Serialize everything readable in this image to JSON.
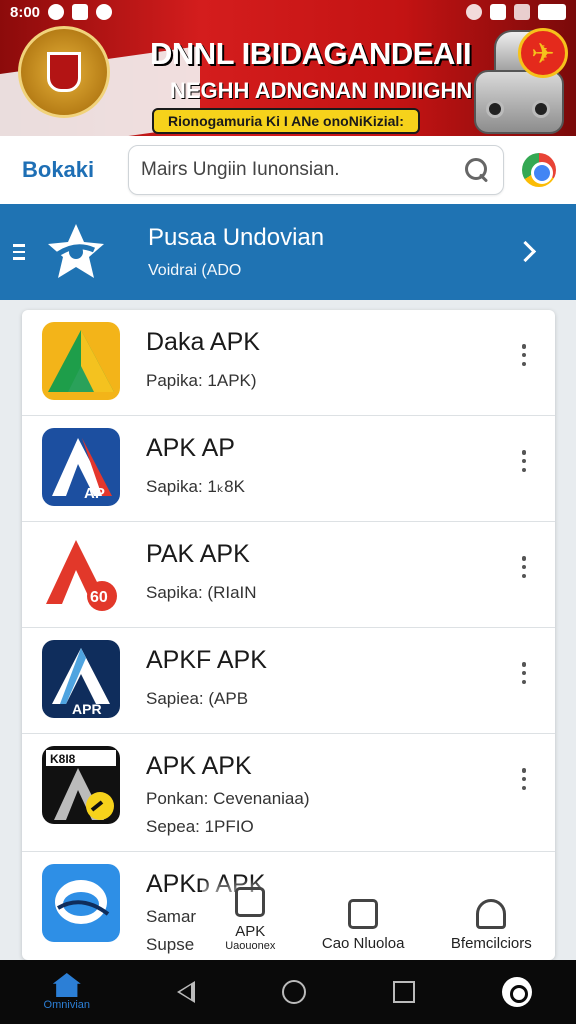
{
  "status_bar": {
    "time": "8:00"
  },
  "banner": {
    "title": "DNNL IBIDAGANDEAII",
    "subtitle": "NEGHH ADNGNAN INDIIGHN",
    "ribbon": "Rionogamuria Ki I ANe onoNiKizial:"
  },
  "header": {
    "brand": "Bokaki",
    "search_placeholder": "Mairs Ungiin Iunonsian."
  },
  "promo": {
    "title": "Pusaa Undovian",
    "subtitle": "Voidrai (ADO"
  },
  "apps": [
    {
      "name": "Daka APK",
      "meta": "Papika: 1APK)"
    },
    {
      "name": "APK AP",
      "meta": "Sapika: 1ₖ8K"
    },
    {
      "name": "PAK APK",
      "meta": "Sapika: (RIaIN"
    },
    {
      "name": "APKF APK",
      "meta": "Sapiea: (APB"
    },
    {
      "name": "APK APK",
      "meta": "Ponkan: Cevenaniaa)",
      "meta2": "Sepea: 1PFIO"
    },
    {
      "name": "APKᴅ APK",
      "meta": "Samar",
      "meta2": "Supse"
    }
  ],
  "bottom_tabs": [
    {
      "label": "APK",
      "sub": "Uaouonex"
    },
    {
      "label": "Cao Nluoloa"
    },
    {
      "label": "Bfemcilciors"
    }
  ],
  "nav": {
    "home_label": "Omnivian"
  },
  "colors": {
    "accent": "#1f73b3",
    "banner_red": "#c31313",
    "ribbon": "#f6d21b"
  }
}
